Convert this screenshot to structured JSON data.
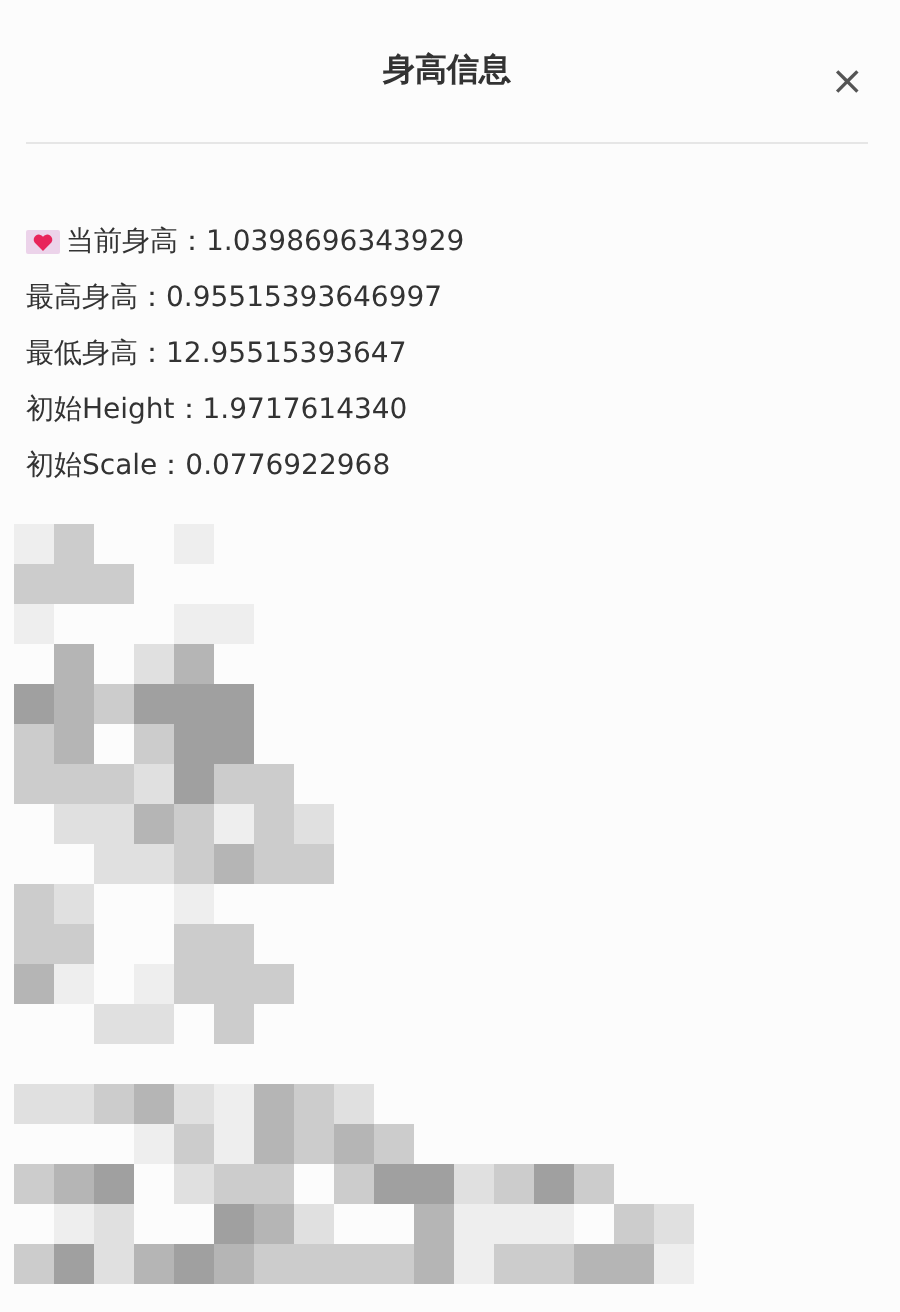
{
  "dialog": {
    "title": "身高信息",
    "close": "×"
  },
  "lines": [
    {
      "kind": "heart",
      "text": "当前身高：1.0398696343929"
    },
    {
      "kind": "plain",
      "text": "最高身高：0.95515393646997"
    },
    {
      "kind": "plain",
      "text": "最低身高：12.95515393647"
    },
    {
      "kind": "plain",
      "text": "初始Height：1.9717614340"
    },
    {
      "kind": "plain",
      "text": "初始Scale：0.0776922968"
    }
  ],
  "image": {
    "kind": "mosaic"
  }
}
